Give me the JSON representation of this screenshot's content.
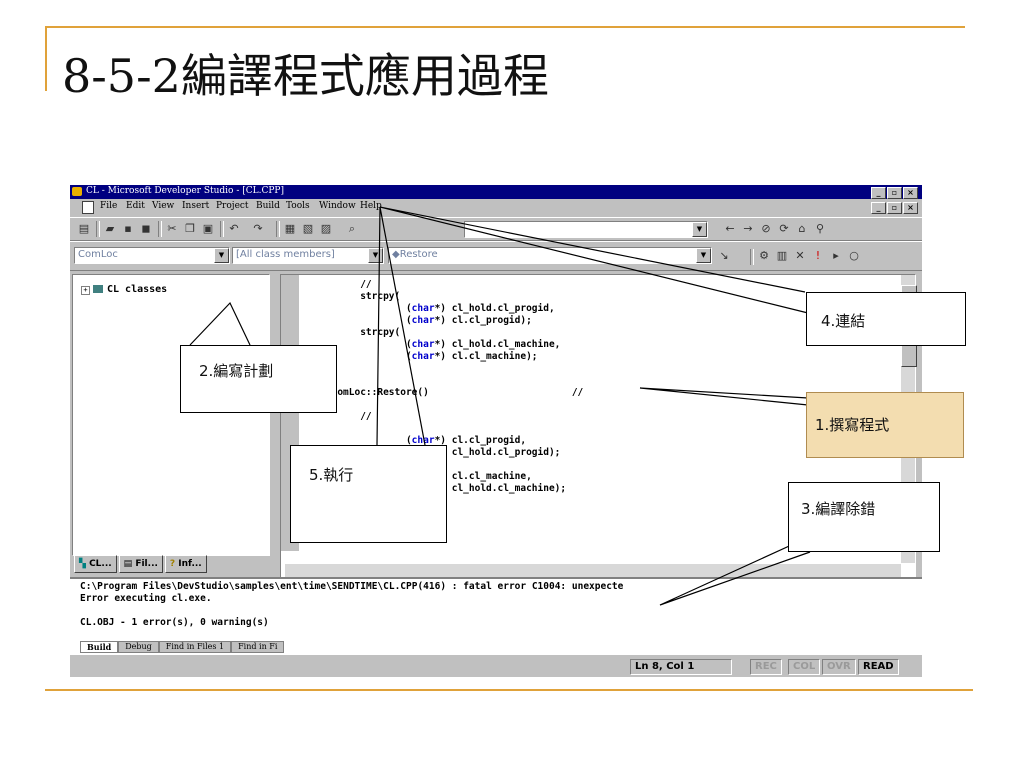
{
  "slide": {
    "title": "8-5-2編譯程式應用過程"
  },
  "window": {
    "title": "CL - Microsoft Developer Studio - [CL.CPP]",
    "controls": [
      "_",
      "▫",
      "×"
    ]
  },
  "menu": {
    "items": [
      "File",
      "Edit",
      "View",
      "Insert",
      "Project",
      "Build",
      "Tools",
      "Window",
      "Help"
    ]
  },
  "wizardbar": {
    "class_combo": "ComLoc",
    "filter_combo": "[All class members]",
    "member_combo": "◆Restore"
  },
  "class_view": {
    "root": "CL classes",
    "tabs": [
      "CL...",
      "Fil...",
      "Inf..."
    ]
  },
  "editor": {
    "lines": [
      {
        "pre": "          //",
        "kw": "",
        "post": ""
      },
      {
        "pre": "          strcpy(",
        "kw": "",
        "post": ""
      },
      {
        "pre": "                  (",
        "kw": "char",
        "post": "*) cl_hold.cl_progid,"
      },
      {
        "pre": "                  (",
        "kw": "char",
        "post": "*) cl.cl_progid);"
      },
      {
        "pre": "          strcpy(",
        "kw": "",
        "post": ""
      },
      {
        "pre": "                  (",
        "kw": "char",
        "post": "*) cl_hold.cl_machine,"
      },
      {
        "pre": "                  (",
        "kw": "char",
        "post": "*) cl.cl_machine);"
      },
      {
        "pre": "",
        "kw": "",
        "post": ""
      },
      {
        "pre": "",
        "kw": "",
        "post": ""
      },
      {
        "pre": "     ComLoc::Restore()                         //",
        "kw": "",
        "post": ""
      },
      {
        "pre": "  {",
        "kw": "",
        "post": ""
      },
      {
        "pre": "          //",
        "kw": "",
        "post": ""
      },
      {
        "pre": "",
        "kw": "",
        "post": ""
      },
      {
        "pre": "                  (",
        "kw": "char",
        "post": "*) cl.cl_progid,"
      },
      {
        "pre": "                  (",
        "kw": "char",
        "post": "*) cl_hold.cl_progid);"
      },
      {
        "pre": "",
        "kw": "",
        "post": ""
      },
      {
        "pre": "                  (",
        "kw": "char",
        "post": "*) cl.cl_machine,"
      },
      {
        "pre": "                  (",
        "kw": "char",
        "post": "*) cl_hold.cl_machine);"
      }
    ]
  },
  "output": {
    "lines": [
      "C:\\Program Files\\DevStudio\\samples\\ent\\time\\SENDTIME\\CL.CPP(416) : fatal error C1004: unexpecte",
      "Error executing cl.exe.",
      "",
      "CL.OBJ - 1 error(s), 0 warning(s)"
    ],
    "tabs": [
      "Build",
      "Debug",
      "Find in Files 1",
      "Find in Fi"
    ]
  },
  "status": {
    "position": "Ln 8, Col 1",
    "indicators": [
      "REC",
      "COL",
      "OVR"
    ],
    "read": "READ"
  },
  "callouts": {
    "write": "1.撰寫程式",
    "plan": "2.編寫計劃",
    "compile": "3.編譯除錯",
    "link": "4.連結",
    "run": "5.執行"
  },
  "colors": {
    "accent_rule": "#e0a23a",
    "titlebar": "#000080",
    "highlight_callout": "#f3ddb0",
    "keyword": "#0000cc"
  }
}
